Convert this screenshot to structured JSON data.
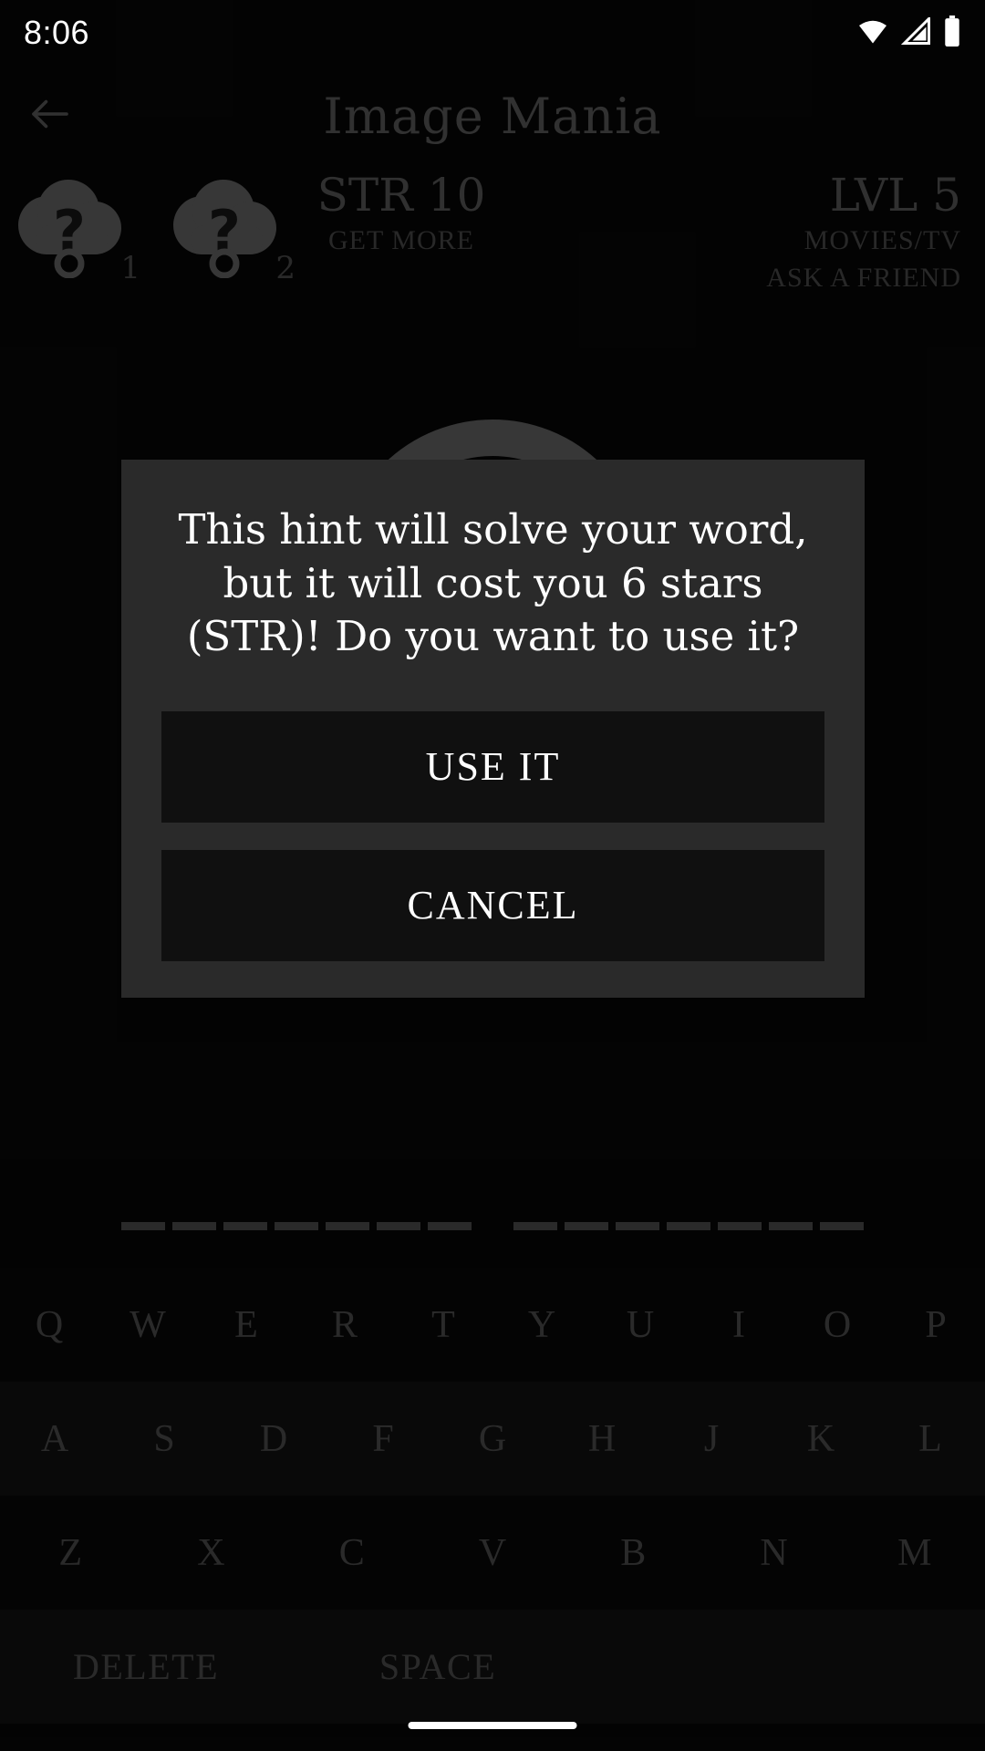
{
  "status_bar": {
    "time": "8:06",
    "icons": [
      "wifi-icon",
      "cellular-signal-icon",
      "battery-icon"
    ]
  },
  "app_bar": {
    "back_icon": "back-arrow-icon",
    "title": "Image Mania"
  },
  "stats": {
    "hints": [
      {
        "icon": "cloud-question-hint-icon",
        "count": "1"
      },
      {
        "icon": "cloud-question-hint-icon",
        "count": "2"
      }
    ],
    "strength": {
      "value": "STR 10",
      "action": "GET MORE"
    },
    "level": {
      "value": "LVL 5",
      "category": "MOVIES/TV",
      "action": "ASK A FRIEND"
    }
  },
  "board": {
    "loading_icon": "loading-ring-icon"
  },
  "answer": {
    "words": [
      {
        "blanks": 7
      },
      {
        "blanks": 7
      }
    ]
  },
  "dialog": {
    "message": "This hint will solve your word, but it will cost you 6 stars (STR)! Do you want to use it?",
    "confirm_label": "USE IT",
    "cancel_label": "CANCEL"
  },
  "keyboard": {
    "row1": [
      "Q",
      "W",
      "E",
      "R",
      "T",
      "Y",
      "U",
      "I",
      "O",
      "P"
    ],
    "row2": [
      "A",
      "S",
      "D",
      "F",
      "G",
      "H",
      "J",
      "K",
      "L"
    ],
    "row3": [
      "Z",
      "X",
      "C",
      "V",
      "B",
      "N",
      "M"
    ],
    "delete_label": "DELETE",
    "space_label": "SPACE"
  },
  "colors": {
    "background": "#080808",
    "dialog_bg": "#2a2a2a",
    "dialog_button_bg": "#101010",
    "dim_text": "#6b6b6b",
    "bright_text": "#ffffff",
    "hint_icon": "#7a7a7a"
  }
}
